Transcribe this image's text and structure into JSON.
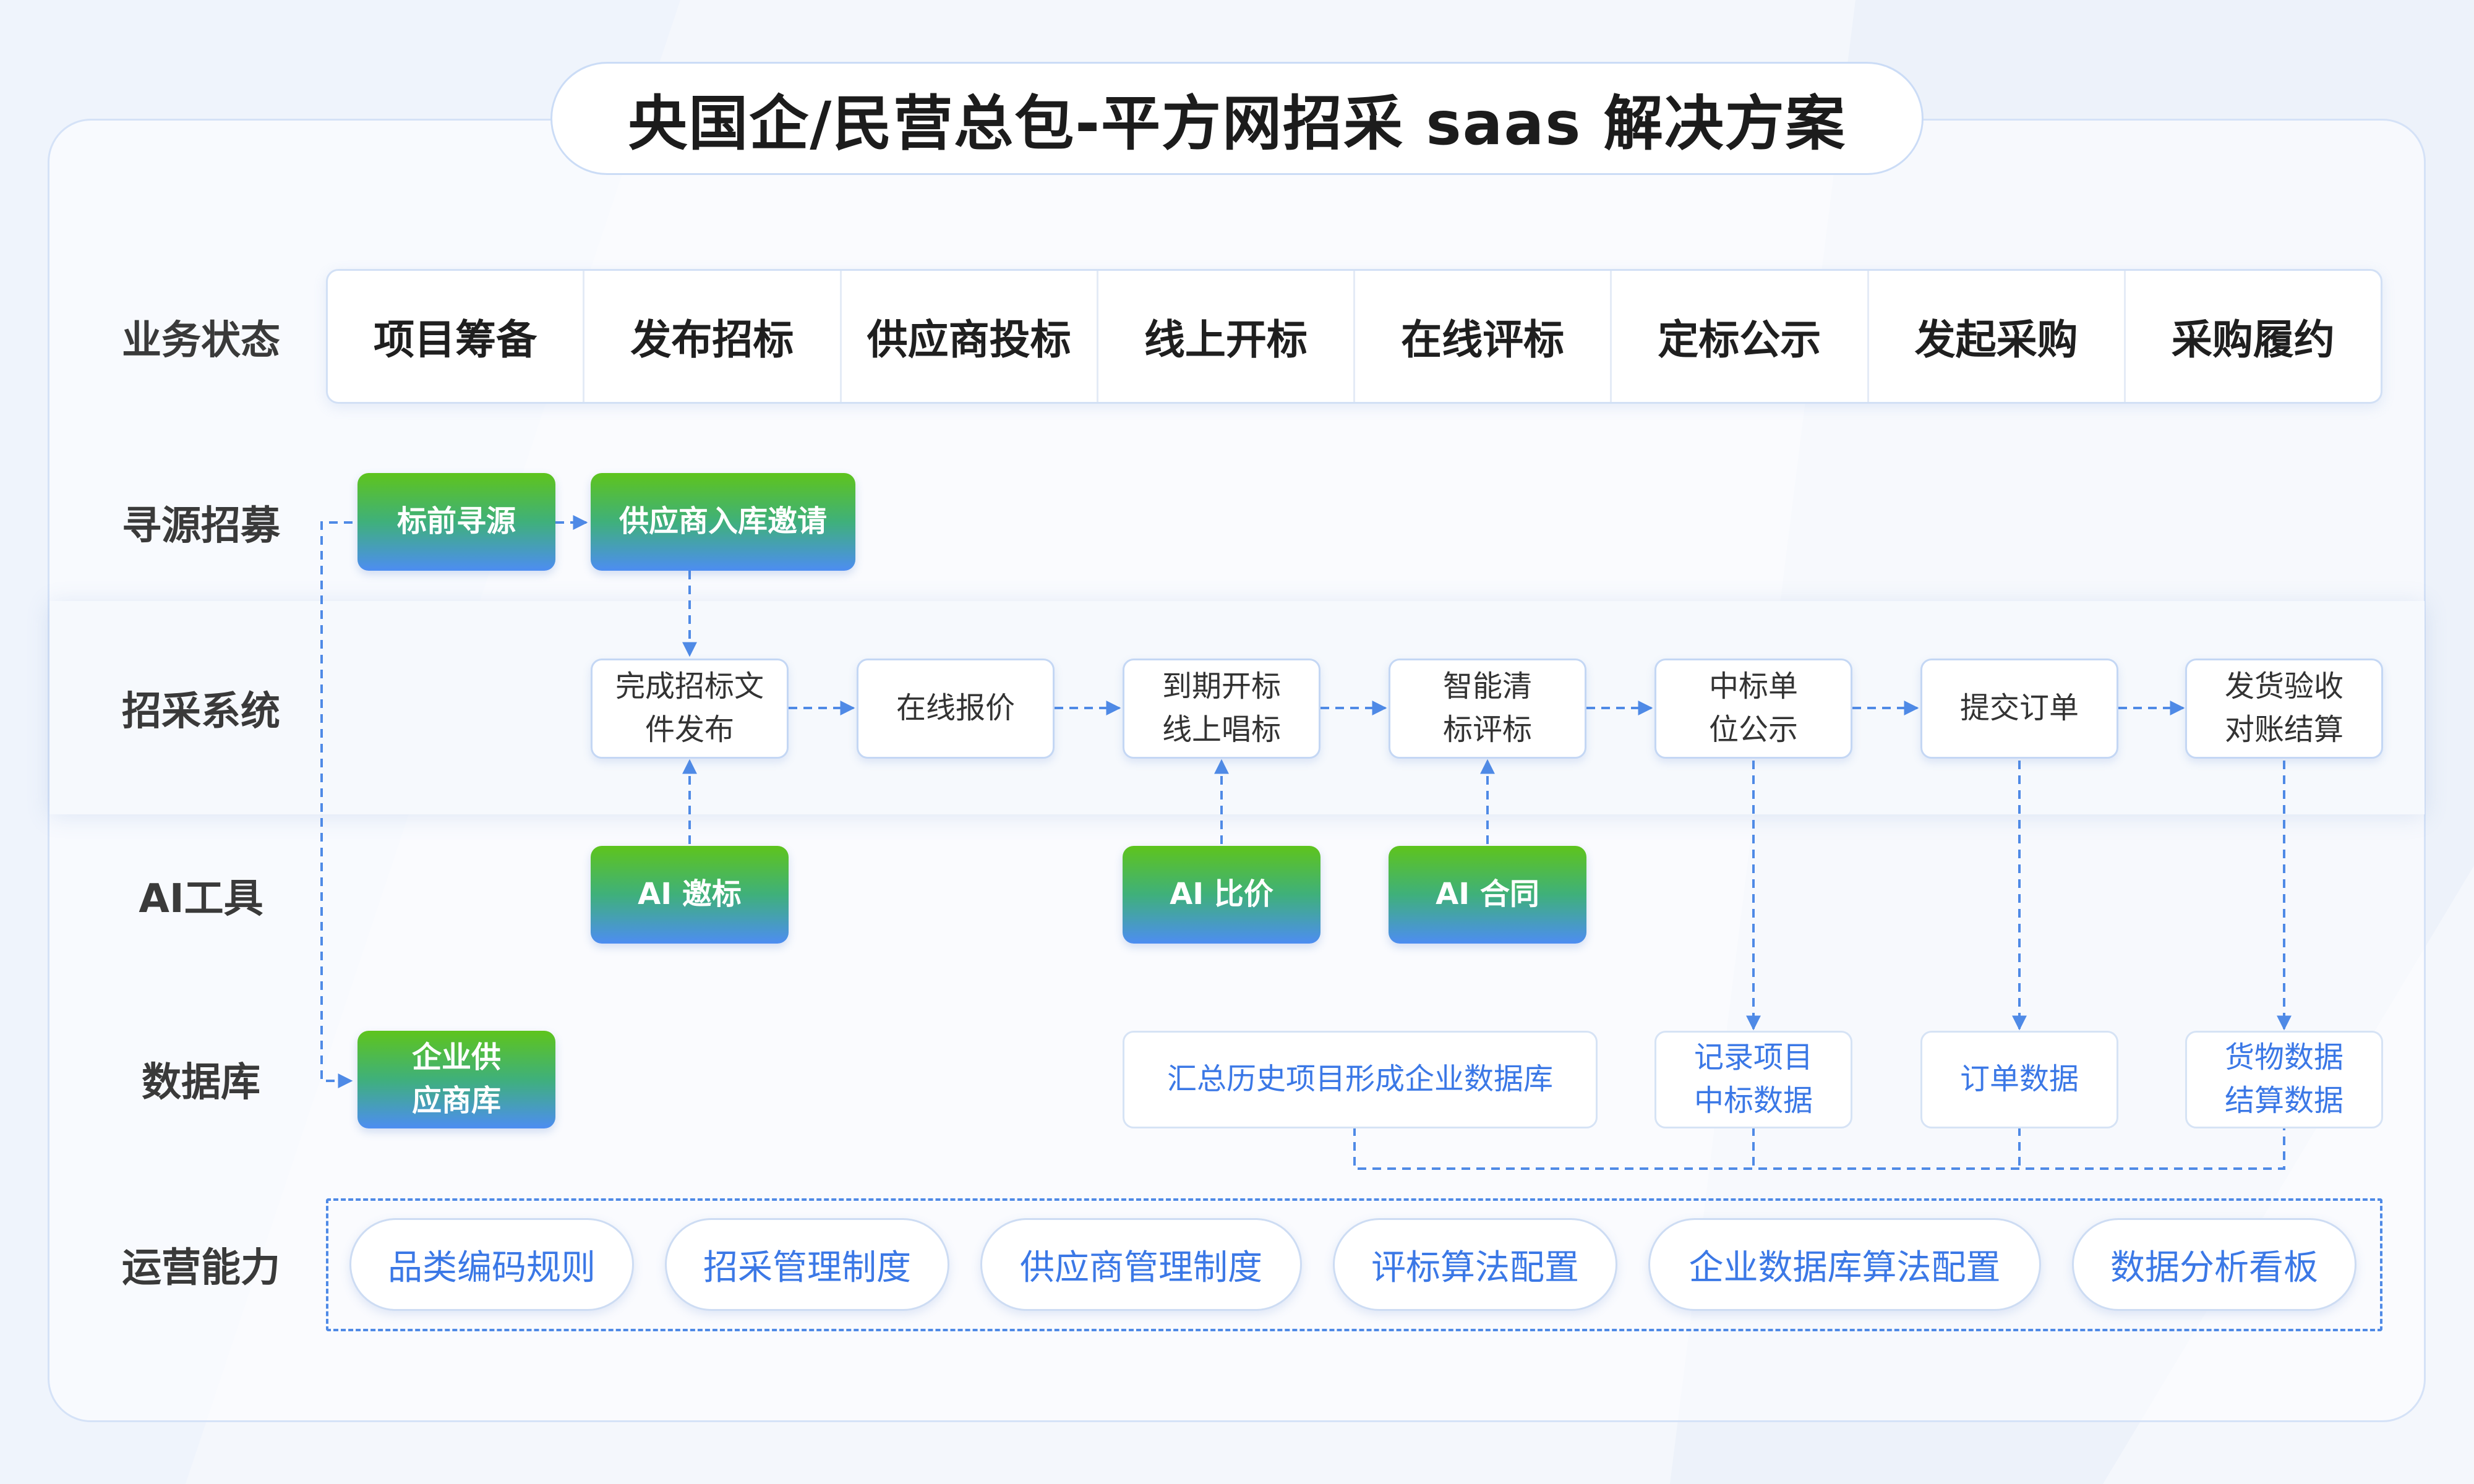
{
  "title": "央国企/民营总包-平方网招采 saas 解决方案",
  "row_labels": {
    "business_status": "业务状态",
    "sourcing": "寻源招募",
    "procurement_system": "招采系统",
    "ai_tools": "AI工具",
    "database": "数据库",
    "operations": "运营能力"
  },
  "stages": [
    "项目筹备",
    "发布招标",
    "供应商投标",
    "线上开标",
    "在线评标",
    "定标公示",
    "发起采购",
    "采购履约"
  ],
  "sourcing": {
    "pre_bid": "标前寻源",
    "invite": "供应商入库邀请"
  },
  "system_steps": {
    "doc_publish": "完成招标文\n件发布",
    "online_quote": "在线报价",
    "open_bid": "到期开标\n线上唱标",
    "smart_eval": "智能清\n标评标",
    "award_notice": "中标单\n位公示",
    "submit_order": "提交订单",
    "delivery": "发货验收\n对账结算"
  },
  "ai_tools": {
    "invite": "AI 邀标",
    "compare": "AI 比价",
    "contract": "AI 合同"
  },
  "database": {
    "supplier_db": "企业供\n应商库",
    "history_db": "汇总历史项目形成企业数据库",
    "award_data": "记录项目\n中标数据",
    "order_data": "订单数据",
    "goods_data": "货物数据\n结算数据"
  },
  "operations": [
    "品类编码规则",
    "招采管理制度",
    "供应商管理制度",
    "评标算法配置",
    "企业数据库算法配置",
    "数据分析看板"
  ],
  "colors": {
    "accent_blue": "#3b78e6",
    "line_blue": "#4f8ae6",
    "green": "#5ec41c"
  }
}
